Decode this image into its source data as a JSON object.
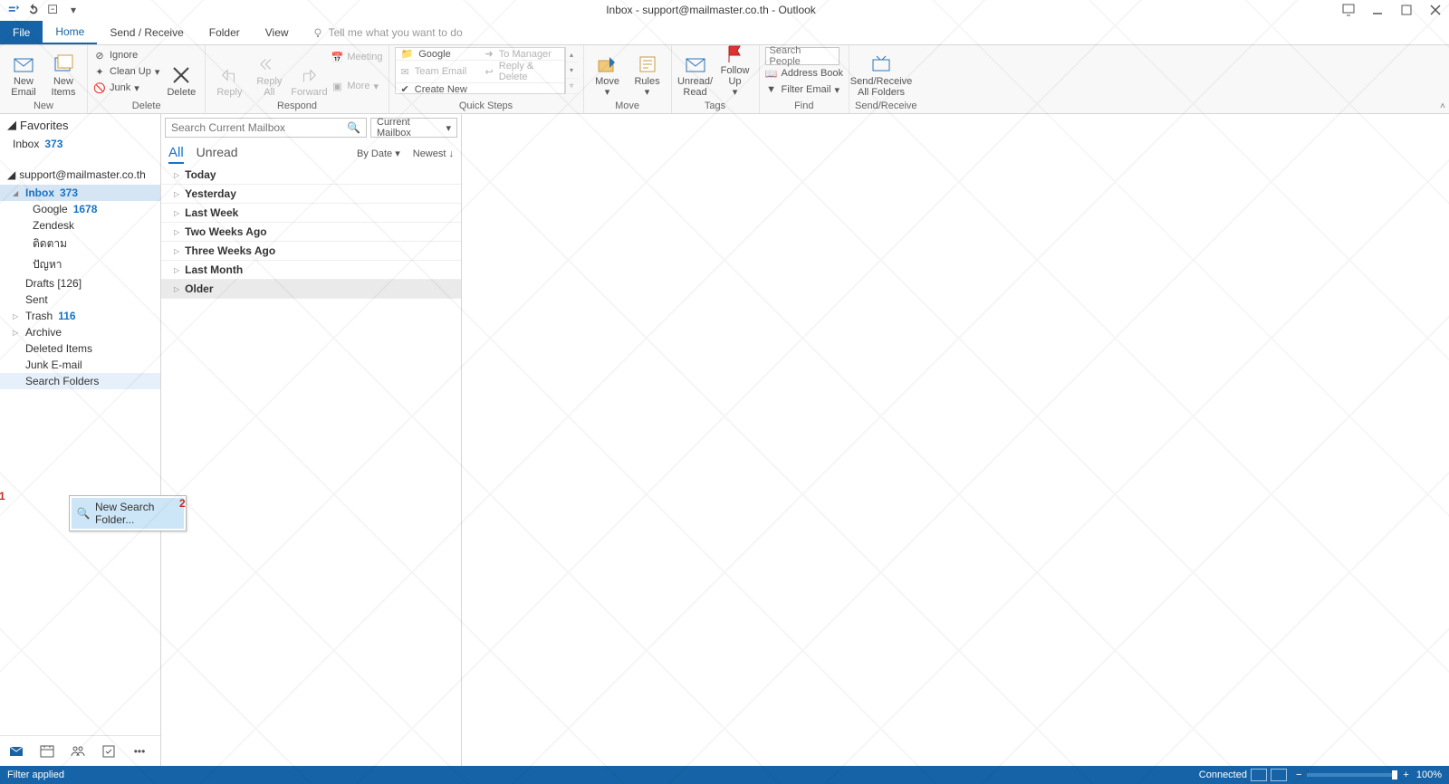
{
  "window": {
    "title": "Inbox - support@mailmaster.co.th - Outlook"
  },
  "ribbon_tabs": {
    "file": "File",
    "home": "Home",
    "send_receive": "Send / Receive",
    "folder": "Folder",
    "view": "View",
    "tell_me_placeholder": "Tell me what you want to do"
  },
  "ribbon": {
    "new": {
      "label": "New",
      "new_email": "New\nEmail",
      "new_items": "New\nItems"
    },
    "delete": {
      "label": "Delete",
      "ignore": "Ignore",
      "clean_up": "Clean Up",
      "junk": "Junk",
      "delete": "Delete"
    },
    "respond": {
      "label": "Respond",
      "reply": "Reply",
      "reply_all": "Reply\nAll",
      "forward": "Forward",
      "meeting": "Meeting",
      "more": "More"
    },
    "quick_steps": {
      "label": "Quick Steps",
      "items": [
        "Google",
        "Team Email",
        "Create New",
        "To Manager",
        "Reply & Delete"
      ]
    },
    "move": {
      "label": "Move",
      "move": "Move",
      "rules": "Rules"
    },
    "tags": {
      "label": "Tags",
      "unread_read": "Unread/\nRead",
      "follow_up": "Follow\nUp"
    },
    "find": {
      "label": "Find",
      "search_people_placeholder": "Search People",
      "address_book": "Address Book",
      "filter_email": "Filter Email"
    },
    "send_receive_grp": {
      "label": "Send/Receive",
      "btn": "Send/Receive\nAll Folders"
    }
  },
  "nav": {
    "favorites": "Favorites",
    "fav_inbox": {
      "name": "Inbox",
      "count": "373"
    },
    "account": "support@mailmaster.co.th",
    "folders": [
      {
        "name": "Inbox",
        "count": "373",
        "selected": true
      },
      {
        "name": "Google",
        "count": "1678",
        "indent": true
      },
      {
        "name": "Zendesk",
        "count": "",
        "indent": true
      },
      {
        "name": "ติดตาม",
        "count": "",
        "indent": true
      },
      {
        "name": "ปัญหา",
        "count": "",
        "indent": true
      },
      {
        "name": "Drafts [126]",
        "count": ""
      },
      {
        "name": "Sent",
        "count": ""
      },
      {
        "name": "Trash",
        "count": "116",
        "expand": true
      },
      {
        "name": "Archive",
        "count": "",
        "expand": true
      },
      {
        "name": "Deleted Items",
        "count": ""
      },
      {
        "name": "Junk E-mail",
        "count": ""
      },
      {
        "name": "Search Folders",
        "count": "",
        "hover": true
      }
    ],
    "callout1": "1",
    "callout2": "2",
    "context_item": "New Search Folder..."
  },
  "msglist": {
    "search_placeholder": "Search Current Mailbox",
    "scope": "Current Mailbox",
    "all": "All",
    "unread": "Unread",
    "by_date": "By Date",
    "newest": "Newest",
    "groups": [
      "Today",
      "Yesterday",
      "Last Week",
      "Two Weeks Ago",
      "Three Weeks Ago",
      "Last Month",
      "Older"
    ]
  },
  "status": {
    "filter": "Filter applied",
    "connected": "Connected",
    "zoom": "100%"
  }
}
